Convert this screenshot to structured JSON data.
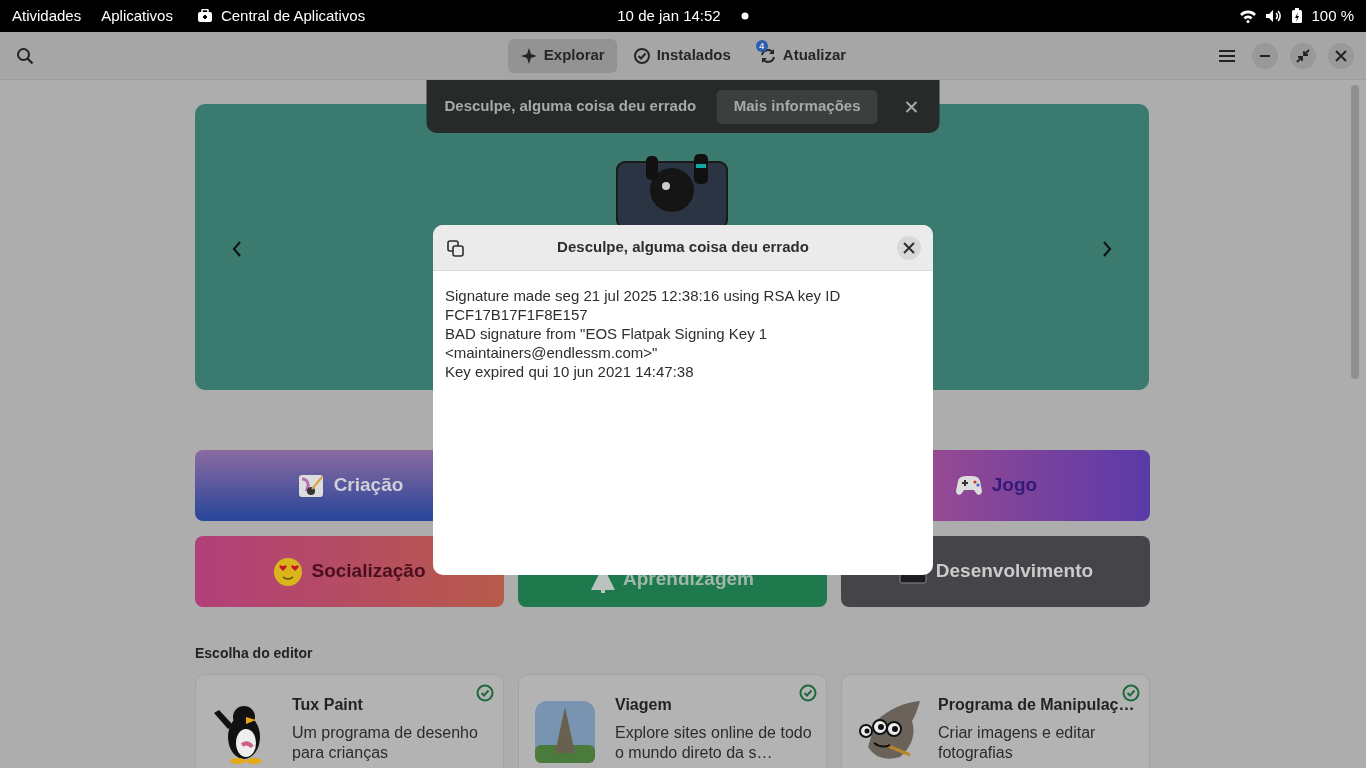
{
  "top_bar": {
    "activities": "Atividades",
    "apps_menu": "Aplicativos",
    "app_name": "Central de Aplicativos",
    "date": "10 de jan",
    "time": "14:52",
    "battery": "100 %"
  },
  "header": {
    "tabs": [
      {
        "label": "Explorar",
        "selected": true,
        "kind": "explore"
      },
      {
        "label": "Instalados",
        "selected": false,
        "kind": "installed"
      },
      {
        "label": "Atualizar",
        "selected": false,
        "kind": "updates",
        "badge": "4"
      }
    ]
  },
  "toast": {
    "message": "Desculpe, alguma coisa deu errado",
    "action": "Mais informações"
  },
  "categories": [
    {
      "label": "Criação",
      "kind": "creation"
    },
    {
      "label": "Jogo",
      "kind": "game"
    },
    {
      "label": "Socialização",
      "kind": "social"
    },
    {
      "label": "Aprendizagem",
      "kind": "learning"
    },
    {
      "label": "Desenvolvimento",
      "kind": "development"
    }
  ],
  "editors_choice": {
    "heading": "Escolha do editor",
    "apps": [
      {
        "title": "Tux Paint",
        "description": "Um programa de desenho para crianças",
        "installed": true,
        "kind": "penguin"
      },
      {
        "title": "Viagem",
        "description": "Explore sites online de todo o mundo direto da s…",
        "installed": true,
        "kind": "photo"
      },
      {
        "title": "Programa de Manipulaç…",
        "description": "Criar imagens e editar fotografias",
        "installed": true,
        "kind": "wilber"
      }
    ]
  },
  "dialog": {
    "title": "Desculpe, alguma coisa deu errado",
    "lines": [
      "Signature made seg 21 jul 2025 12:38:16 using RSA key ID FCF17B17F1F8E157",
      "BAD signature from \"EOS Flatpak Signing Key 1 <maintainers@endlessm.com>\"",
      "Key expired qui 10 jun 2021 14:47:38"
    ]
  }
}
